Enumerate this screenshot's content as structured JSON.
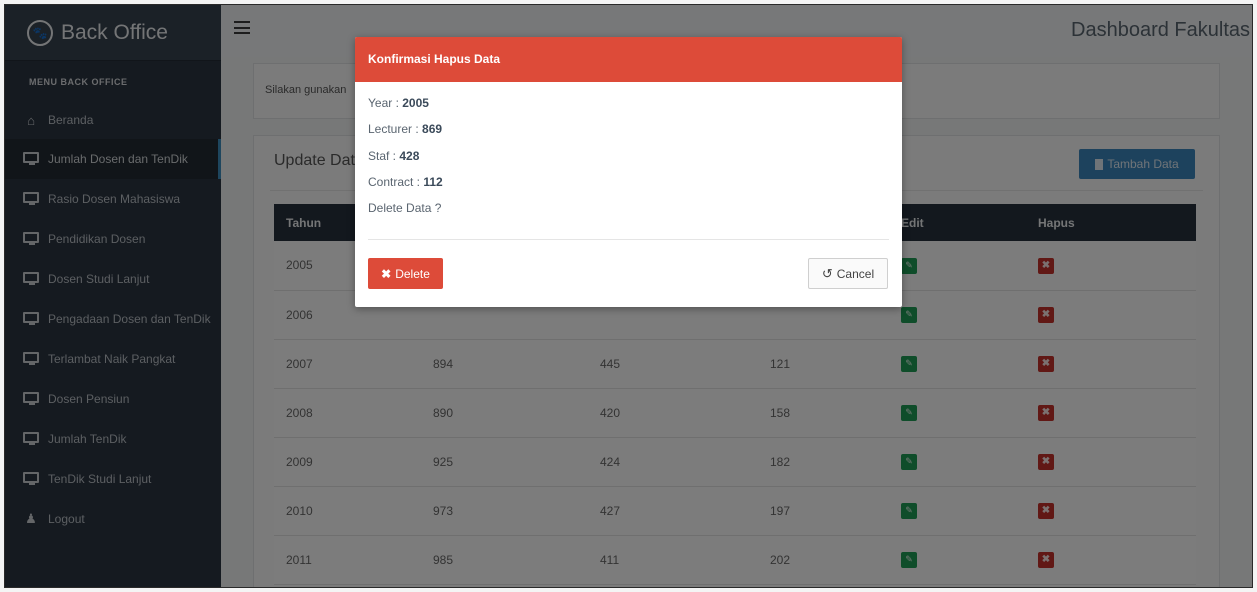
{
  "sidebar": {
    "brand": "Back Office",
    "menu_header": "MENU BACK OFFICE",
    "items": [
      {
        "label": "Beranda",
        "icon": "home-icon"
      },
      {
        "label": "Jumlah Dosen dan TenDik",
        "icon": "monitor-icon"
      },
      {
        "label": "Rasio Dosen Mahasiswa",
        "icon": "monitor-icon"
      },
      {
        "label": "Pendidikan Dosen",
        "icon": "monitor-icon"
      },
      {
        "label": "Dosen Studi Lanjut",
        "icon": "monitor-icon"
      },
      {
        "label": "Pengadaan Dosen dan TenDik",
        "icon": "monitor-icon"
      },
      {
        "label": "Terlambat Naik Pangkat",
        "icon": "monitor-icon"
      },
      {
        "label": "Dosen Pensiun",
        "icon": "monitor-icon"
      },
      {
        "label": "Jumlah TenDik",
        "icon": "monitor-icon"
      },
      {
        "label": "TenDik Studi Lanjut",
        "icon": "monitor-icon"
      },
      {
        "label": "Logout",
        "icon": "user-icon"
      }
    ]
  },
  "header": {
    "title": "Dashboard Fakultas"
  },
  "info_box": {
    "text": "Silakan gunakan"
  },
  "main": {
    "title": "Update Data",
    "add_button": "Tambah Data",
    "columns": [
      "Tahun",
      "",
      "",
      "",
      "Edit",
      "Hapus"
    ],
    "rows": [
      [
        "2005",
        "",
        "",
        ""
      ],
      [
        "2006",
        "",
        "",
        ""
      ],
      [
        "2007",
        "894",
        "445",
        "121"
      ],
      [
        "2008",
        "890",
        "420",
        "158"
      ],
      [
        "2009",
        "925",
        "424",
        "182"
      ],
      [
        "2010",
        "973",
        "427",
        "197"
      ],
      [
        "2011",
        "985",
        "411",
        "202"
      ]
    ]
  },
  "modal": {
    "title": "Konfirmasi Hapus Data",
    "year_label": "Year : ",
    "year_value": "2005",
    "lecturer_label": "Lecturer : ",
    "lecturer_value": "869",
    "staf_label": "Staf : ",
    "staf_value": "428",
    "contract_label": "Contract : ",
    "contract_value": "112",
    "question": "Delete Data ?",
    "delete_label": "Delete",
    "cancel_label": "Cancel"
  },
  "colors": {
    "accent": "#3c8dbc",
    "danger": "#dd4b39",
    "sidebar": "#2a3440",
    "success": "#1f9b55"
  }
}
